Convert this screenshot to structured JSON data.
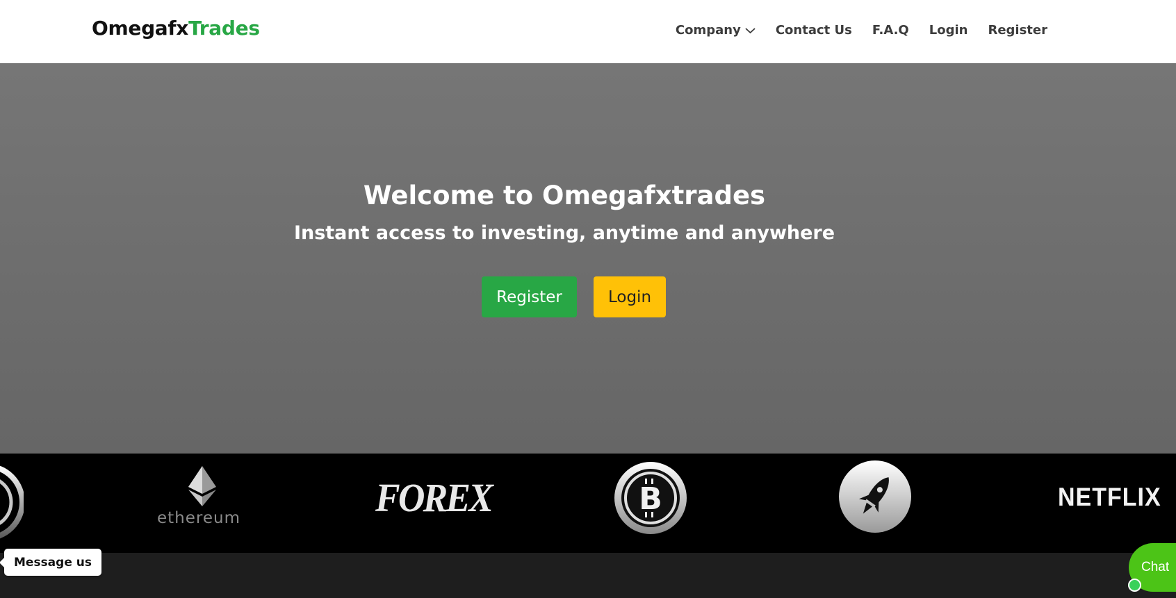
{
  "header": {
    "logo_part1": "Omegafx",
    "logo_part2": "Trades",
    "nav": [
      {
        "label": "Company",
        "icon": "chevron-down-icon"
      },
      {
        "label": "Contact Us"
      },
      {
        "label": "F.A.Q"
      },
      {
        "label": "Login"
      },
      {
        "label": "Register"
      }
    ]
  },
  "hero": {
    "title": "Welcome to Omegafxtrades",
    "subtitle": "Instant access to investing, anytime and anywhere",
    "register_label": "Register",
    "login_label": "Login"
  },
  "partners": {
    "ethereum": "ethereum",
    "forex": "FOREX",
    "netflix": "NETFLIX",
    "icons": [
      "partial-coin-icon",
      "ethereum-icon",
      "bitcoin-icon",
      "rocket-icon"
    ]
  },
  "widgets": {
    "message_us": "Message us",
    "chat": "Chat"
  },
  "colors": {
    "brand_green": "#28a745",
    "login_yellow": "#ffc107",
    "chat_green": "#4cc417"
  }
}
